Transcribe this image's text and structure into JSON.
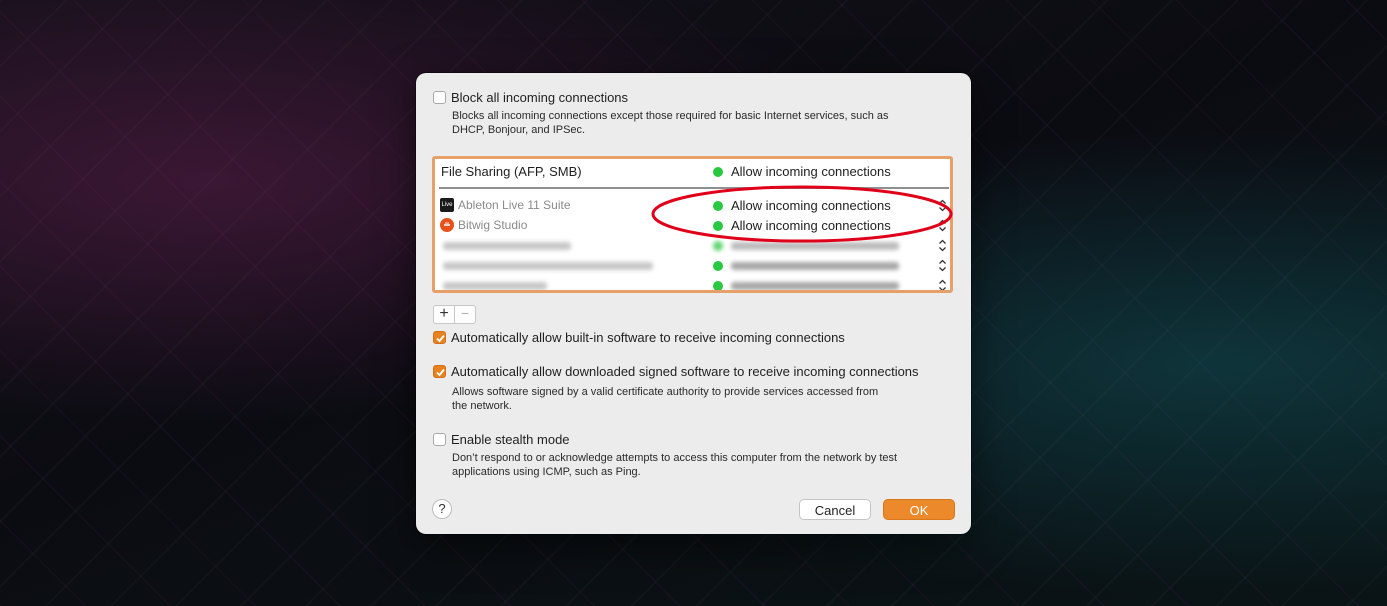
{
  "block_all": {
    "checked": false,
    "label": "Block all incoming connections",
    "description_line1": "Blocks all incoming connections except those required for basic Internet services, such as",
    "description_line2": "DHCP, Bonjour, and IPSec."
  },
  "services": {
    "header": {
      "name": "File Sharing (AFP, SMB)",
      "status": "Allow incoming connections"
    },
    "apps": [
      {
        "name": "Ableton Live 11 Suite",
        "icon": "ableton-live-icon",
        "icon_text": "Live",
        "status": "Allow incoming connections"
      },
      {
        "name": "Bitwig Studio",
        "icon": "bitwig-studio-icon",
        "status": "Allow incoming connections"
      },
      {
        "name": "",
        "status": ""
      },
      {
        "name": "",
        "status": ""
      },
      {
        "name": "",
        "status": ""
      }
    ]
  },
  "list_controls": {
    "add": "+",
    "remove": "−"
  },
  "auto_builtin": {
    "checked": true,
    "label": "Automatically allow built-in software to receive incoming connections"
  },
  "auto_signed": {
    "checked": true,
    "label": "Automatically allow downloaded signed software to receive incoming connections",
    "description_line1": "Allows software signed by a valid certificate authority to provide services accessed from",
    "description_line2": "the network."
  },
  "stealth": {
    "checked": false,
    "label": "Enable stealth mode",
    "description_line1": "Don’t respond to or acknowledge attempts to access this computer from the network by test",
    "description_line2": "applications using ICMP, such as Ping."
  },
  "buttons": {
    "help": "?",
    "cancel": "Cancel",
    "ok": "OK"
  },
  "colors": {
    "accent": "#ec8a2b",
    "status_green": "#28c840",
    "highlight_ring": "#e0001a",
    "list_border": "#e8a06a"
  }
}
